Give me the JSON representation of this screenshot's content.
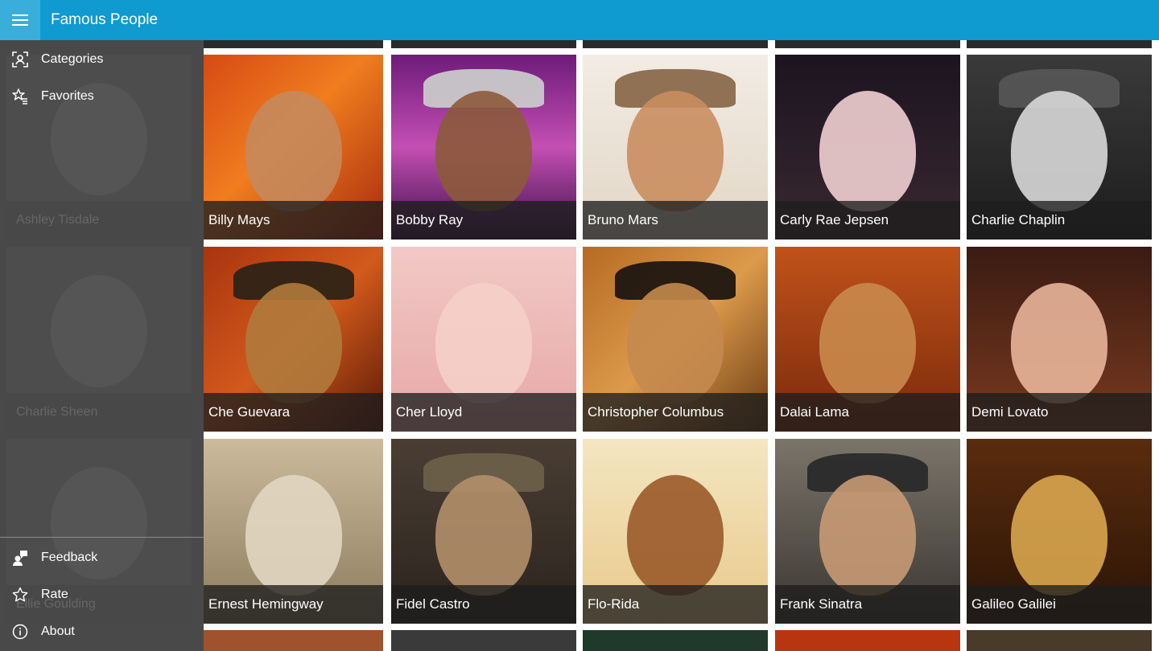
{
  "app": {
    "title": "Famous People"
  },
  "nav": {
    "top": [
      {
        "label": "Categories",
        "icon": "categories-icon"
      },
      {
        "label": "Favorites",
        "icon": "favorites-icon"
      }
    ],
    "bottom": [
      {
        "label": "Feedback",
        "icon": "feedback-icon"
      },
      {
        "label": "Rate",
        "icon": "rate-icon"
      },
      {
        "label": "About",
        "icon": "about-icon"
      }
    ],
    "ghost_tiles": [
      "Ashley Tisdale",
      "Charlie Sheen",
      "Ellie Goulding"
    ]
  },
  "tiles": [
    [
      "Billy Mays",
      "Bobby Ray",
      "Bruno Mars",
      "Carly Rae Jepsen",
      "Charlie Chaplin"
    ],
    [
      "Che Guevara",
      "Cher Lloyd",
      "Christopher Columbus",
      "Dalai Lama",
      "Demi Lovato"
    ],
    [
      "Ernest Hemingway",
      "Fidel Castro",
      "Flo-Rida",
      "Frank Sinatra",
      "Galileo Galilei"
    ]
  ],
  "colors": {
    "titlebar": "#0f9ad0",
    "hamburger_bg": "#3aaedb",
    "nav_bg": "#3a3a3a"
  }
}
